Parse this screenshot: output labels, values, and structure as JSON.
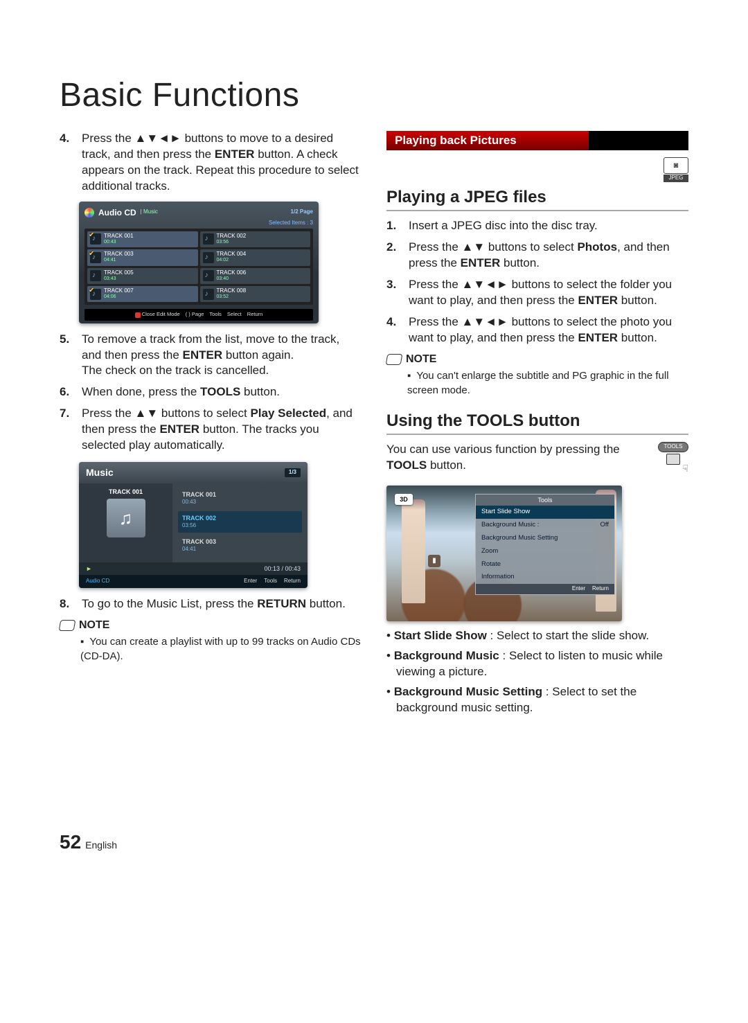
{
  "page": {
    "title": "Basic Functions",
    "number": "52",
    "language": "English"
  },
  "left": {
    "step4": {
      "num": "4.",
      "pre": "Press the ",
      "icons": "▲▼◄►",
      "mid": " buttons to move to a desired track, and then press the ",
      "enter": "ENTER",
      "post": " button. A check appears on the track. Repeat this procedure to select additional tracks."
    },
    "shot1": {
      "title": "Audio CD",
      "cat": "| Music",
      "page": "1/2 Page",
      "selected": "Selected Items : 3",
      "tracks": [
        {
          "t": "TRACK 001",
          "d": "00:43",
          "chk": true
        },
        {
          "t": "TRACK 002",
          "d": "03:56",
          "chk": false
        },
        {
          "t": "TRACK 003",
          "d": "04:41",
          "chk": true
        },
        {
          "t": "TRACK 004",
          "d": "04:02",
          "chk": false
        },
        {
          "t": "TRACK 005",
          "d": "03:43",
          "chk": false
        },
        {
          "t": "TRACK 006",
          "d": "03:40",
          "chk": false
        },
        {
          "t": "TRACK 007",
          "d": "04:06",
          "chk": true
        },
        {
          "t": "TRACK 008",
          "d": "03:52",
          "chk": false
        }
      ],
      "ftr": {
        "close": "Close Edit Mode",
        "page": "( ) Page",
        "tools": "Tools",
        "select": "Select",
        "ret": "Return"
      }
    },
    "step5": {
      "num": "5.",
      "pre": "To remove a track from the list, move to the track, and then press the ",
      "enter": "ENTER",
      "mid": " button again.",
      "post": "The check on the track is cancelled."
    },
    "step6": {
      "num": "6.",
      "pre": "When done, press the ",
      "tools": "TOOLS",
      "post": " button."
    },
    "step7": {
      "num": "7.",
      "pre": "Press the ",
      "icons": "▲▼",
      "mid": " buttons to select ",
      "ps": "Play Selected",
      "mid2": ", and then press the ",
      "enter": "ENTER",
      "post": " button. The tracks you selected play automatically."
    },
    "shot2": {
      "title": "Music",
      "page": "1/3",
      "left_label": "TRACK 001",
      "note_glyph": "♫",
      "tracks": [
        {
          "t": "TRACK 001",
          "d": "00:43",
          "sel": false
        },
        {
          "t": "TRACK 002",
          "d": "03:56",
          "sel": true
        },
        {
          "t": "TRACK 003",
          "d": "04:41",
          "sel": false
        }
      ],
      "play_icon": "►",
      "time": "00:13 / 00:43",
      "src": "Audio CD",
      "enter": "Enter",
      "tools": "Tools",
      "ret": "Return"
    },
    "step8": {
      "num": "8.",
      "pre": "To go to the Music List, press the ",
      "ret": "RETURN",
      "post": " button."
    },
    "note_label": "NOTE",
    "note_item": "You can create a playlist with up to 99 tracks on Audio CDs (CD-DA)."
  },
  "right": {
    "section": "Playing back Pictures",
    "jpeg_icon": "◙",
    "jpeg_text": "JPEG",
    "h_play": "Playing a JPEG files",
    "s1": {
      "num": "1.",
      "txt": "Insert a JPEG disc into the disc tray."
    },
    "s2": {
      "num": "2.",
      "pre": "Press the ",
      "icons": "▲▼",
      "mid": " buttons to select ",
      "ph": "Photos",
      "mid2": ", and then press the ",
      "enter": "ENTER",
      "post": " button."
    },
    "s3": {
      "num": "3.",
      "pre": "Press the ",
      "icons": "▲▼◄►",
      "mid": " buttons to select the folder you want to play, and then press the ",
      "enter": "ENTER",
      "post": " button."
    },
    "s4": {
      "num": "4.",
      "pre": "Press the ",
      "icons": "▲▼◄►",
      "mid": " buttons to select the photo you want to play, and then press the ",
      "enter": "ENTER",
      "post": " button."
    },
    "note_label": "NOTE",
    "note_item": "You can't enlarge the subtitle and PG graphic in the full screen mode.",
    "h_tools": "Using the TOOLS button",
    "tools_desc_pre": "You can use various function by pressing the ",
    "tools_bold": "TOOLS",
    "tools_desc_post": " button.",
    "tools_btn_label": "TOOLS",
    "hand_glyph": "☟",
    "shot3": {
      "btn3d": "3D",
      "left_icon": "▮",
      "title": "Tools",
      "items": [
        {
          "t": "Start Slide Show",
          "v": "",
          "sel": true
        },
        {
          "t": "Background Music    :",
          "v": "Off",
          "sel": false
        },
        {
          "t": "Background Music Setting",
          "v": "",
          "sel": false
        },
        {
          "t": "Zoom",
          "v": "",
          "sel": false
        },
        {
          "t": "Rotate",
          "v": "",
          "sel": false
        },
        {
          "t": "Information",
          "v": "",
          "sel": false
        }
      ],
      "enter": "Enter",
      "ret": "Return"
    },
    "bullets": {
      "b1a": "Start Slide Show",
      "b1b": " : Select to start the slide show.",
      "b2a": "Background Music",
      "b2b": " : Select to listen to music while viewing a picture.",
      "b3a": "Background Music Setting",
      "b3b": " : Select to set the background music setting."
    }
  }
}
